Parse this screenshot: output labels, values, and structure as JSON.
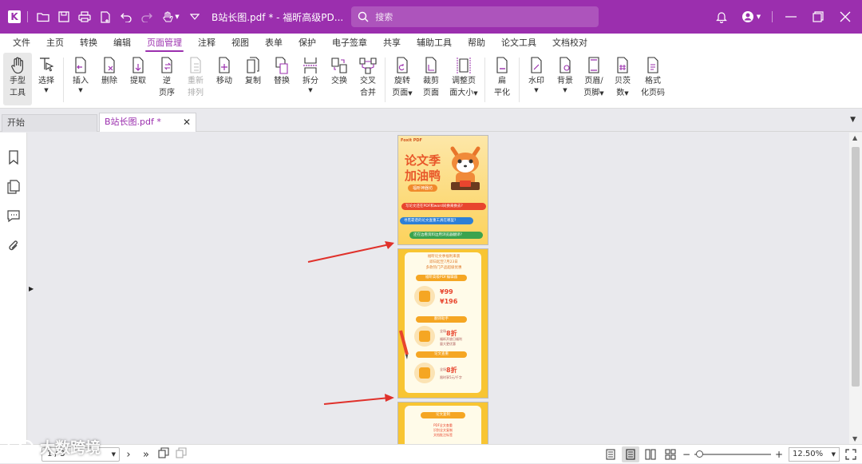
{
  "titlebar": {
    "title": "B站长图.pdf * - 福昕高级PD...",
    "search_placeholder": "搜索",
    "accent": "#9b2fae"
  },
  "menu": [
    "文件",
    "主页",
    "转换",
    "编辑",
    "页面管理",
    "注释",
    "视图",
    "表单",
    "保护",
    "电子签章",
    "共享",
    "辅助工具",
    "帮助",
    "论文工具",
    "文档校对"
  ],
  "menu_active_index": 4,
  "ribbon": {
    "hand": [
      "手型",
      "工具"
    ],
    "select": "选择",
    "insert": "插入",
    "delete": "删除",
    "extract": "提取",
    "reverse": [
      "逆",
      "页序"
    ],
    "rearrange": [
      "重新",
      "排列"
    ],
    "move": "移动",
    "copy": "复制",
    "replace": "替换",
    "split": "拆分",
    "swap": "交换",
    "cross_merge": [
      "交叉",
      "合并"
    ],
    "rotate": [
      "旋转",
      "页面"
    ],
    "crop": [
      "裁剪",
      "页面"
    ],
    "resize": [
      "调整页",
      "面大小"
    ],
    "flatten": [
      "扁",
      "平化"
    ],
    "watermark": "水印",
    "background": "背景",
    "header_footer": [
      "页眉/",
      "页脚"
    ],
    "bates": [
      "贝茨",
      "数"
    ],
    "format_page_number": [
      "格式",
      "化页码"
    ]
  },
  "tabs": {
    "start": "开始",
    "doc": "B站长图.pdf *"
  },
  "page_content": {
    "p1_brand": "Foxit PDF",
    "p1_headline": [
      "论文季",
      "加油鸭"
    ],
    "p1_badge": "福昕神器坊",
    "p1_pills": [
      "写论文还在PDF和word间换来换去?",
      "寻觅靠谱的论文查重工具在哪里?",
      "还在边看资料边用浏览器翻译?"
    ],
    "p2_intro": [
      "福昕论文季福利来袭",
      "即日起至7月23日",
      "多款热门产品超级优惠"
    ],
    "p2_bar1": "福昕高级PDF编辑器",
    "p2_price1": "¥99",
    "p2_price2": "¥196",
    "p2_bar2": "翻译助手",
    "p2_price3": "8折",
    "p2_small3": [
      "全场",
      "福昕开放日福利",
      "量大更优惠"
    ],
    "p2_bar3": "论文查重",
    "p2_price4": "8折",
    "p2_small4": [
      "全场",
      "限时享5元/千字"
    ],
    "p3_bar": "论文复制",
    "p3_text": [
      "PDF全文查重",
      "识别全文复制",
      "文档批注标签"
    ]
  },
  "statusbar": {
    "page": "1 / 3",
    "zoom": "12.50%"
  },
  "watermark": "大数跨境"
}
